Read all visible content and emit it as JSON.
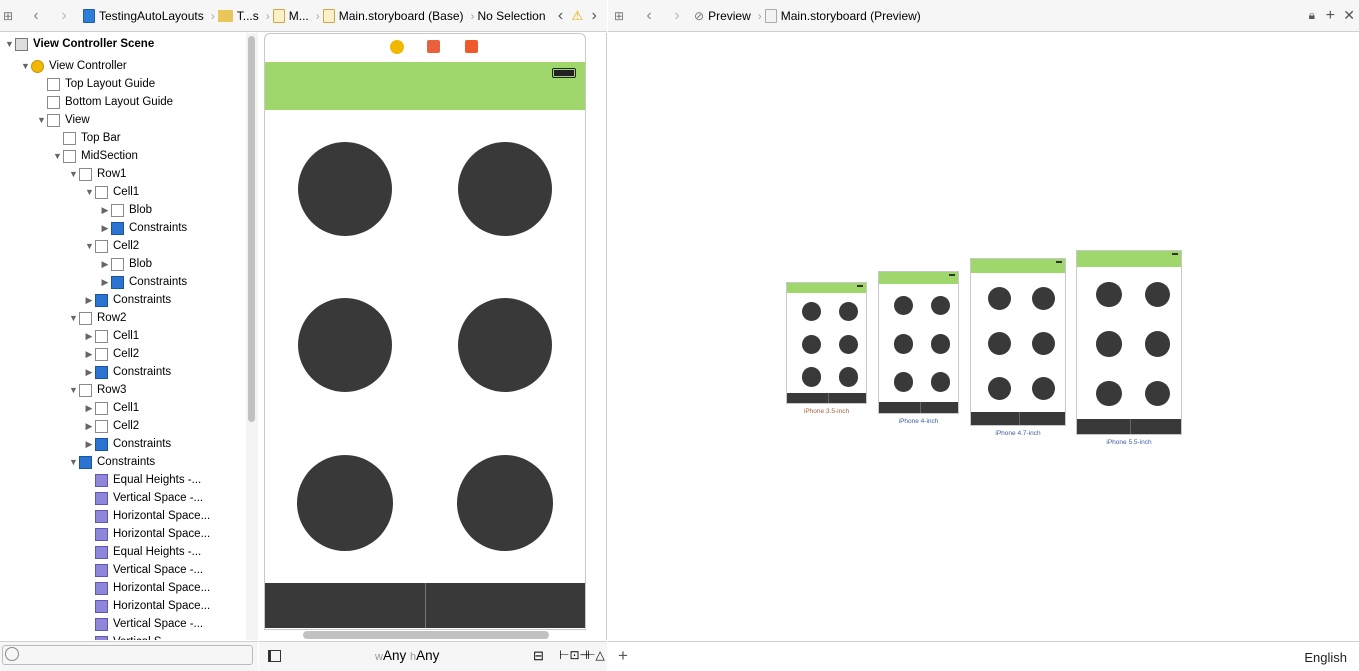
{
  "left_bar": {
    "crumbs": [
      "TestingAutoLayouts",
      "T...s",
      "M...",
      "Main.storyboard (Base)",
      "No Selection"
    ]
  },
  "right_bar": {
    "crumbs": [
      "Preview",
      "Main.storyboard (Preview)"
    ]
  },
  "outline": [
    {
      "label": "View Controller Scene",
      "level": 0,
      "arrow": "down",
      "icon": "scene",
      "bold": true
    },
    {
      "label": "View Controller",
      "level": 1,
      "arrow": "down",
      "icon": "vc"
    },
    {
      "label": "Top Layout Guide",
      "level": 2,
      "icon": "view"
    },
    {
      "label": "Bottom Layout Guide",
      "level": 2,
      "icon": "view"
    },
    {
      "label": "View",
      "level": 2,
      "arrow": "down",
      "icon": "view"
    },
    {
      "label": "Top Bar",
      "level": 3,
      "icon": "view"
    },
    {
      "label": "MidSection",
      "level": 3,
      "arrow": "down",
      "icon": "view"
    },
    {
      "label": "Row1",
      "level": 4,
      "arrow": "down",
      "icon": "view"
    },
    {
      "label": "Cell1",
      "level": 5,
      "arrow": "down",
      "icon": "view"
    },
    {
      "label": "Blob",
      "level": 6,
      "arrow": "right",
      "icon": "view"
    },
    {
      "label": "Constraints",
      "level": 6,
      "arrow": "right",
      "icon": "cons"
    },
    {
      "label": "Cell2",
      "level": 5,
      "arrow": "down",
      "icon": "view"
    },
    {
      "label": "Blob",
      "level": 6,
      "arrow": "right",
      "icon": "view"
    },
    {
      "label": "Constraints",
      "level": 6,
      "arrow": "right",
      "icon": "cons"
    },
    {
      "label": "Constraints",
      "level": 5,
      "arrow": "right",
      "icon": "cons"
    },
    {
      "label": "Row2",
      "level": 4,
      "arrow": "down",
      "icon": "view"
    },
    {
      "label": "Cell1",
      "level": 5,
      "arrow": "right",
      "icon": "view"
    },
    {
      "label": "Cell2",
      "level": 5,
      "arrow": "right",
      "icon": "view"
    },
    {
      "label": "Constraints",
      "level": 5,
      "arrow": "right",
      "icon": "cons"
    },
    {
      "label": "Row3",
      "level": 4,
      "arrow": "down",
      "icon": "view"
    },
    {
      "label": "Cell1",
      "level": 5,
      "arrow": "right",
      "icon": "view"
    },
    {
      "label": "Cell2",
      "level": 5,
      "arrow": "right",
      "icon": "view"
    },
    {
      "label": "Constraints",
      "level": 5,
      "arrow": "right",
      "icon": "cons"
    },
    {
      "label": "Constraints",
      "level": 4,
      "arrow": "down",
      "icon": "cons"
    },
    {
      "label": "Equal Heights -...",
      "level": 5,
      "icon": "lc"
    },
    {
      "label": "Vertical Space -...",
      "level": 5,
      "icon": "lc"
    },
    {
      "label": "Horizontal Space...",
      "level": 5,
      "icon": "lc"
    },
    {
      "label": "Horizontal Space...",
      "level": 5,
      "icon": "lc"
    },
    {
      "label": "Equal Heights -...",
      "level": 5,
      "icon": "lc"
    },
    {
      "label": "Vertical Space -...",
      "level": 5,
      "icon": "lc"
    },
    {
      "label": "Horizontal Space...",
      "level": 5,
      "icon": "lc"
    },
    {
      "label": "Horizontal Space...",
      "level": 5,
      "icon": "lc"
    },
    {
      "label": "Vertical Space -...",
      "level": 5,
      "icon": "lc"
    },
    {
      "label": "Vertical S...",
      "level": 5,
      "icon": "lc"
    }
  ],
  "canvas": {
    "size_w": "w",
    "size_w_val": "Any",
    "size_h": "h",
    "size_h_val": "Any"
  },
  "previews": [
    "iPhone 3.5-inch",
    "iPhone 4-inch",
    "iPhone 4.7-inch",
    "iPhone 5.5-inch"
  ],
  "language": "English",
  "colors": {
    "top_bar": "#a0d76c",
    "blob": "#393939",
    "bottom_bar": "#393939"
  }
}
